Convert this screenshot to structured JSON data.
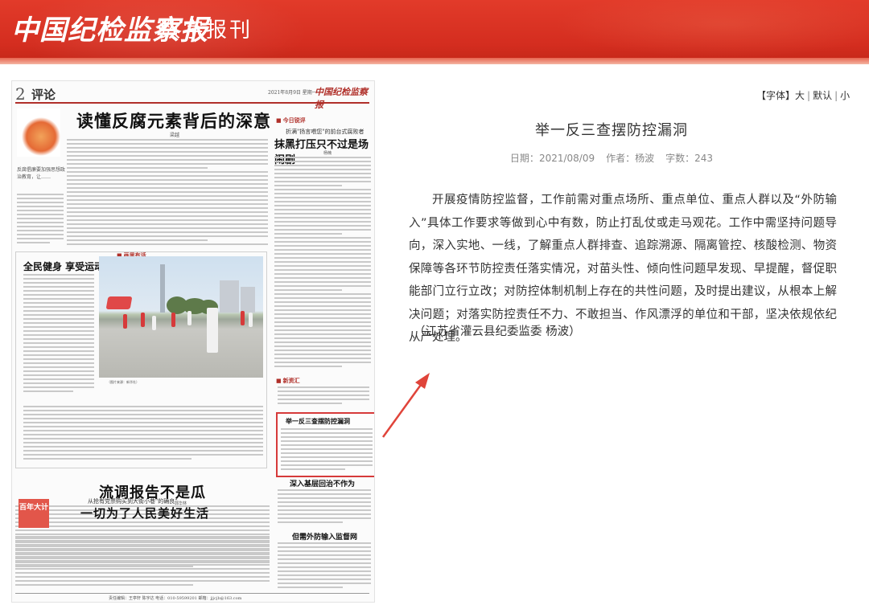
{
  "header": {
    "paper_name": "中国纪检监察报",
    "edition_name": "数字报刊"
  },
  "page_thumbnail": {
    "page_number": "2",
    "section": "评论",
    "date_line": "2021年8月9日 星期一",
    "masthead_small": "中国纪检监察报",
    "main_headline": "读懂反腐元素背后的深意",
    "main_byline": "梁越",
    "orn_caption": "反腐倡廉要加强思想政治教育，让……",
    "side_tag": "今日锐评",
    "side_subtitle": "折满\"扬言喂您\"的前台式腐败者",
    "side_headline": "抹黑打压只不过是场闹剧",
    "side_byline": "杨楠",
    "feature_tag": "画里有话",
    "feature_headline": "全民健身 享受运动",
    "photo_caption": "（图片来源：新华社）",
    "tag_3": "新资汇",
    "center_headline": "流调报告不是瓜",
    "center_byline": "郭华林",
    "highlighted_headline": "举一反三查摆防控漏洞",
    "side_headline_2": "深入基层回治不作为",
    "side_headline_3": "但需外防输入监督网",
    "bottom_badge": "百年大计",
    "bottom_subtitle": "从抢有党票购买到大街小巷\"的确良\"",
    "bottom_headline": "一切为了人民美好生活",
    "footer": "责任编辑：王亭轩 陈宇达 电话：010-59599201 邮箱：jjjcjb@163.com"
  },
  "font_control": {
    "prefix": "【字体】",
    "options": [
      "大",
      "默认",
      "小"
    ]
  },
  "article": {
    "title": "举一反三查摆防控漏洞",
    "date_label": "日期：",
    "date": "2021/08/09",
    "author_label": "作者：",
    "author": "杨波",
    "wordcount_label": "字数：",
    "wordcount": "243",
    "body": "开展疫情防控监督，工作前需对重点场所、重点单位、重点人群以及“外防输入”具体工作要求等做到心中有数，防止打乱仗或走马观花。工作中需坚持问题导向，深入实地、一线，了解重点人群排查、追踪溯源、隔离管控、核酸检测、物资保障等各环节防控责任落实情况，对苗头性、倾向性问题早发现、早提醒，督促职能部门立行立改；对防控体制机制上存在的共性问题，及时提出建议，从根本上解决问题；对落实防控责任不力、不敢担当、作风漂浮的单位和干部，坚决依规依纪从严处理。",
    "signature": "（江苏省灌云县纪委监委 杨波）"
  },
  "colors": {
    "banner_red": "#d42d1f",
    "highlight_red": "#d63a3a",
    "text_gray": "#333333",
    "meta_gray": "#888888"
  }
}
